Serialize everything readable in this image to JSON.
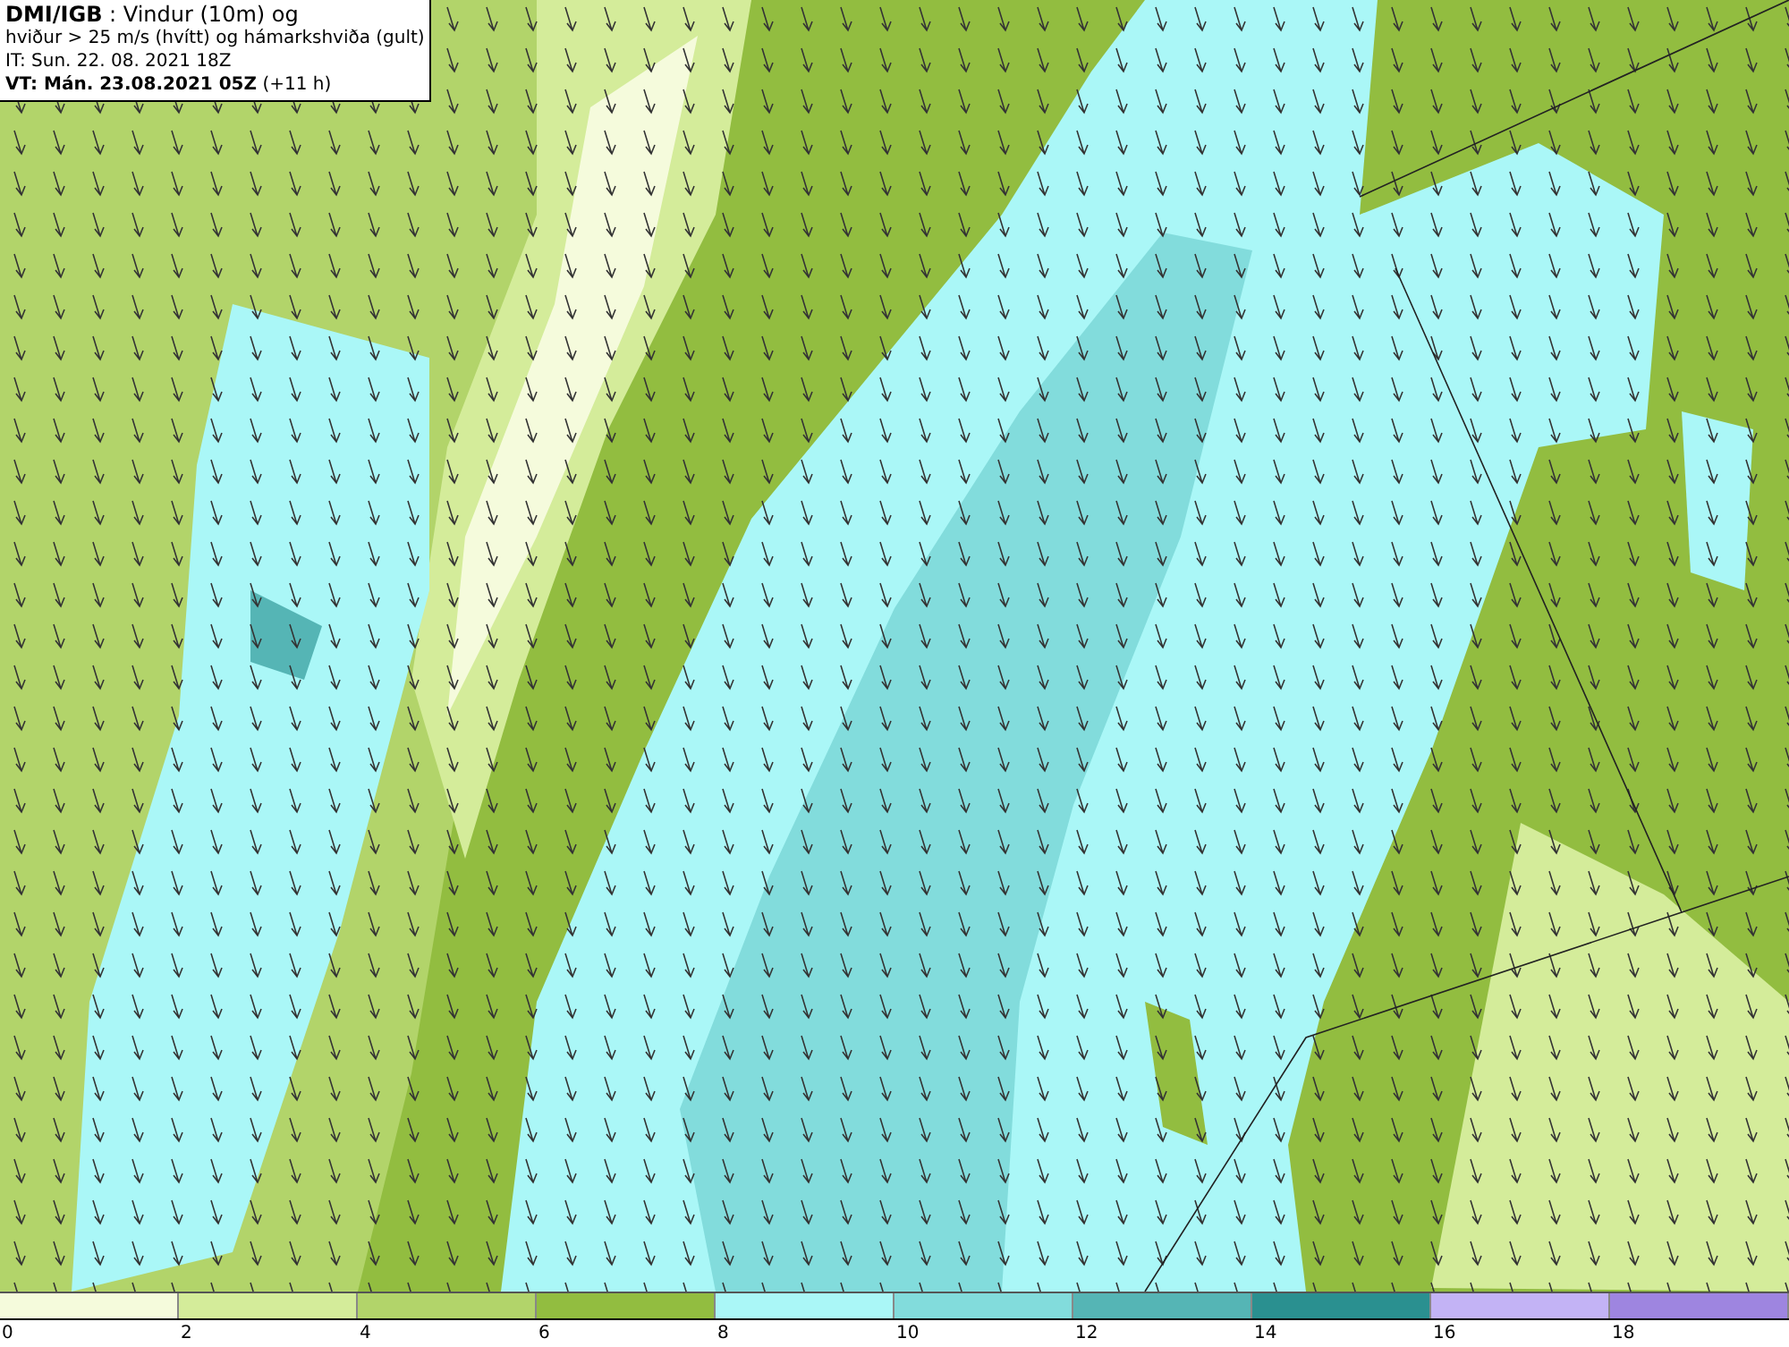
{
  "caption": {
    "lines": [
      "**DMI/IGB** : Vindur (10m) og",
      "hviður > 25 m/s (hvítt) og hámarkshviða (gult)",
      "IT: Sun. 22. 08. 2021 18Z",
      "**VT: Mán. 23.08.2021 05Z** (+11 h)"
    ]
  },
  "legend": {
    "bins": [
      {
        "label": "0",
        "color": "#f5fbdc"
      },
      {
        "label": "2",
        "color": "#d4ec9a"
      },
      {
        "label": "4",
        "color": "#b2d46a"
      },
      {
        "label": "6",
        "color": "#92bd40"
      },
      {
        "label": "8",
        "color": "#aaf7f7"
      },
      {
        "label": "10",
        "color": "#82dcdc"
      },
      {
        "label": "12",
        "color": "#55b5b5"
      },
      {
        "label": "14",
        "color": "#2a9090"
      },
      {
        "label": "16",
        "color": "#c3b3f5"
      },
      {
        "label": "18",
        "color": "#9e85e0"
      }
    ]
  }
}
